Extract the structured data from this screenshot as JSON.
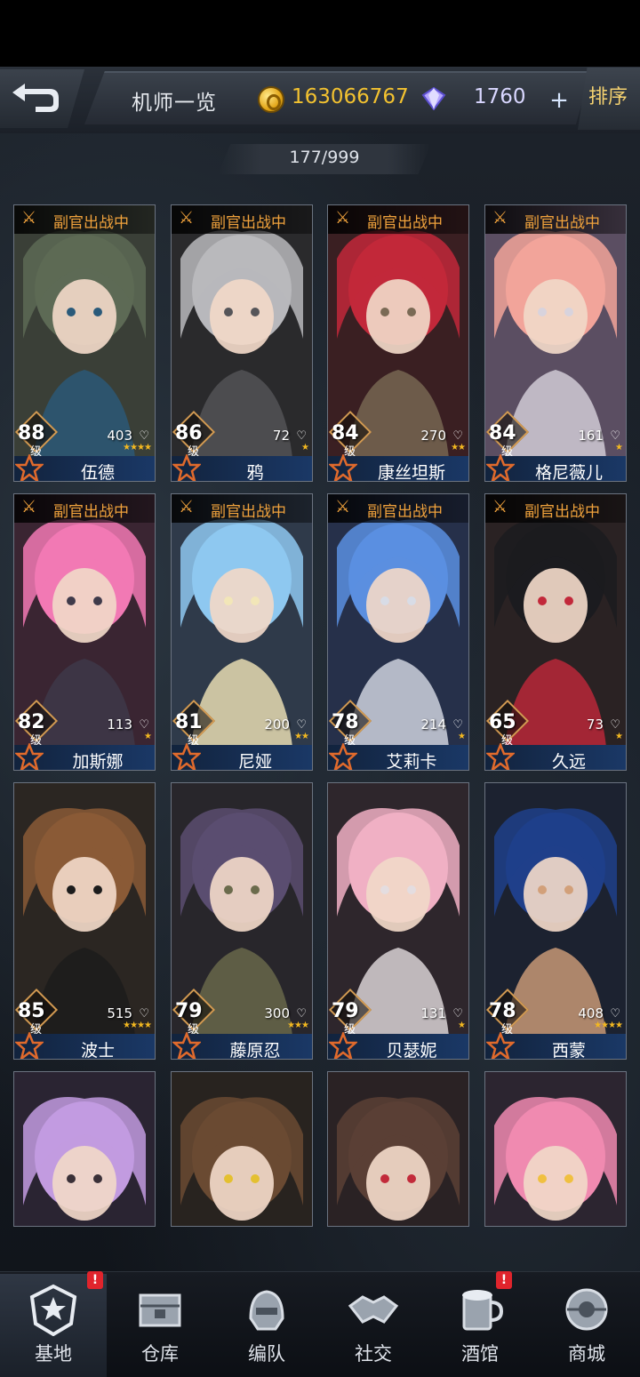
{
  "header": {
    "title": "机师一览",
    "coins": "163066767",
    "gems": "1760",
    "plus_label": "+",
    "sort_label": "排序"
  },
  "count": "177/999",
  "level_suffix": "级",
  "heart_glyph": "♡",
  "pilots": [
    {
      "name": "伍德",
      "level": "88",
      "power": "403",
      "stars": "★★★★",
      "aide": "副官出战中",
      "palette": [
        "#3a3f37",
        "#5d6a55",
        "#2a5a7a"
      ]
    },
    {
      "name": "鸦",
      "level": "86",
      "power": "72",
      "stars": "★",
      "aide": "副官出战中",
      "palette": [
        "#2a2a2c",
        "#b8b8bc",
        "#555559"
      ]
    },
    {
      "name": "康丝坦斯",
      "level": "84",
      "power": "270",
      "stars": "★★",
      "aide": "副官出战中",
      "palette": [
        "#3a1f22",
        "#c2283a",
        "#7a6a55"
      ]
    },
    {
      "name": "格尼薇儿",
      "level": "84",
      "power": "161",
      "stars": "★",
      "aide": "副官出战中",
      "palette": [
        "#5b4e62",
        "#f2a49a",
        "#d8d3dd"
      ]
    },
    {
      "name": "加斯娜",
      "level": "82",
      "power": "113",
      "stars": "★",
      "aide": "副官出战中",
      "palette": [
        "#3a2532",
        "#f279b4",
        "#3f3a4a"
      ]
    },
    {
      "name": "尼娅",
      "level": "81",
      "power": "200",
      "stars": "★★",
      "aide": "副官出战中",
      "palette": [
        "#2f3a4a",
        "#8ec8f0",
        "#f2e6b8"
      ]
    },
    {
      "name": "艾莉卡",
      "level": "78",
      "power": "214",
      "stars": "★",
      "aide": "副官出战中",
      "palette": [
        "#26304a",
        "#5b8fe0",
        "#d8dce6"
      ]
    },
    {
      "name": "久远",
      "level": "65",
      "power": "73",
      "stars": "★",
      "aide": "副官出战中",
      "palette": [
        "#2a2223",
        "#1b1b1f",
        "#c2283a"
      ]
    },
    {
      "name": "波士",
      "level": "85",
      "power": "515",
      "stars": "★★★★",
      "aide": "",
      "palette": [
        "#2b2622",
        "#8a5a36",
        "#1c1c1c"
      ]
    },
    {
      "name": "藤原忍",
      "level": "79",
      "power": "300",
      "stars": "★★★",
      "aide": "",
      "palette": [
        "#28262b",
        "#5a4d70",
        "#6b6b4c"
      ]
    },
    {
      "name": "贝瑟妮",
      "level": "79",
      "power": "131",
      "stars": "★",
      "aide": "",
      "palette": [
        "#2e262c",
        "#f0b0c4",
        "#e4dde0"
      ]
    },
    {
      "name": "西蒙",
      "level": "78",
      "power": "408",
      "stars": "★★★★",
      "aide": "",
      "palette": [
        "#1c2230",
        "#1f3f8a",
        "#d2a07a"
      ]
    },
    {
      "name": "",
      "level": "",
      "power": "",
      "stars": "",
      "aide": "",
      "palette": [
        "#2a2432",
        "#c29be0",
        "#3a3038"
      ]
    },
    {
      "name": "",
      "level": "",
      "power": "",
      "stars": "",
      "aide": "",
      "palette": [
        "#28231f",
        "#6a4a32",
        "#e4c030"
      ]
    },
    {
      "name": "",
      "level": "",
      "power": "",
      "stars": "",
      "aide": "",
      "palette": [
        "#2a2224",
        "#5a3f35",
        "#c22a3a"
      ]
    },
    {
      "name": "",
      "level": "",
      "power": "",
      "stars": "",
      "aide": "",
      "palette": [
        "#2c2530",
        "#f08ab0",
        "#f0c040"
      ]
    }
  ],
  "nav": [
    {
      "label": "基地",
      "icon": "base-emblem-icon",
      "active": true,
      "badge": "!"
    },
    {
      "label": "仓库",
      "icon": "warehouse-crate-icon",
      "active": false,
      "badge": ""
    },
    {
      "label": "编队",
      "icon": "formation-helmet-icon",
      "active": false,
      "badge": ""
    },
    {
      "label": "社交",
      "icon": "handshake-icon",
      "active": false,
      "badge": ""
    },
    {
      "label": "酒馆",
      "icon": "tavern-mug-icon",
      "active": false,
      "badge": "!"
    },
    {
      "label": "商城",
      "icon": "shop-sphere-icon",
      "active": false,
      "badge": ""
    }
  ]
}
